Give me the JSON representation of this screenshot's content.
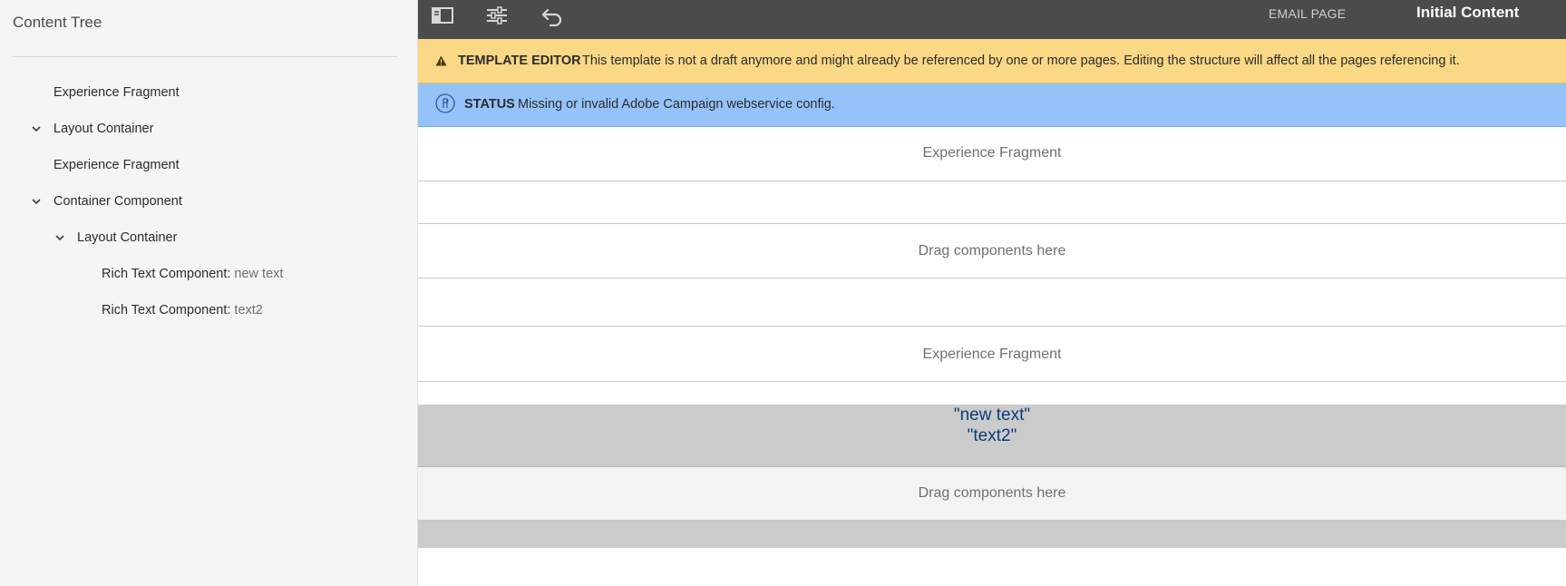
{
  "sidebar": {
    "title": "Content Tree",
    "items": [
      {
        "label": "Experience Fragment",
        "suffix": "",
        "expandable": false
      },
      {
        "label": "Layout Container",
        "suffix": "",
        "expandable": true
      },
      {
        "label": "Experience Fragment",
        "suffix": "",
        "expandable": false
      },
      {
        "label": "Container Component",
        "suffix": "",
        "expandable": true
      },
      {
        "label": "Layout Container",
        "suffix": "",
        "expandable": true
      },
      {
        "label": "Rich Text Component: ",
        "suffix": "new text",
        "expandable": false
      },
      {
        "label": "Rich Text Component: ",
        "suffix": "text2",
        "expandable": false
      }
    ]
  },
  "toolbar": {
    "icons": [
      "toggle-side-panel-icon",
      "page-properties-icon",
      "undo-icon"
    ],
    "page_type": "EMAIL PAGE",
    "mode": "Initial Content"
  },
  "alerts": {
    "warning": {
      "title": "TEMPLATE EDITOR",
      "message": "This template is not a draft anymore and might already be referenced by one or more pages. Editing the structure will affect all the pages referencing it.",
      "icon": "alert-icon"
    },
    "status": {
      "title": "STATUS",
      "message": "Missing or invalid Adobe Campaign webservice config.",
      "icon": "campaign-icon"
    }
  },
  "content": {
    "row1": "Experience Fragment",
    "row3": "Drag components here",
    "row5": "Experience Fragment",
    "rich_line1": "\"new text\"",
    "rich_line2": "\"text2\"",
    "drag_bottom": "Drag components here"
  },
  "colors": {
    "toolbar_bg": "#4b4b4b",
    "warning_bg": "#fad886",
    "status_bg": "#96c2fa",
    "rich_text_color": "#0c3c7c",
    "sidebar_bg": "#f5f5f5"
  }
}
